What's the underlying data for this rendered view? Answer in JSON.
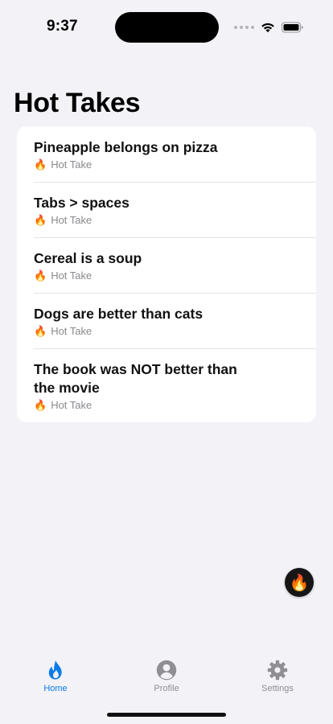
{
  "status_bar": {
    "time": "9:37"
  },
  "page": {
    "title": "Hot Takes"
  },
  "takes": [
    {
      "title": "Pineapple belongs on pizza",
      "flame": "🔥",
      "label": "Hot Take"
    },
    {
      "title": "Tabs > spaces",
      "flame": "🔥",
      "label": "Hot Take"
    },
    {
      "title": "Cereal is a soup",
      "flame": "🔥",
      "label": "Hot Take"
    },
    {
      "title": "Dogs are better than cats",
      "flame": "🔥",
      "label": "Hot Take"
    },
    {
      "title": "The book was NOT better than the movie",
      "flame": "🔥",
      "label": "Hot Take"
    }
  ],
  "fab": {
    "icon": "fire-icon",
    "glyph": "🔥"
  },
  "tab_bar": {
    "tabs": [
      {
        "label": "Home",
        "icon": "flame-icon",
        "active": true
      },
      {
        "label": "Profile",
        "icon": "person-circle-icon",
        "active": false
      },
      {
        "label": "Settings",
        "icon": "gear-icon",
        "active": false
      }
    ]
  },
  "colors": {
    "accent": "#0a7be8",
    "inactive": "#8e8e93",
    "background": "#f2f2f7",
    "card": "#ffffff",
    "secondary_text": "#8a8a8e"
  }
}
